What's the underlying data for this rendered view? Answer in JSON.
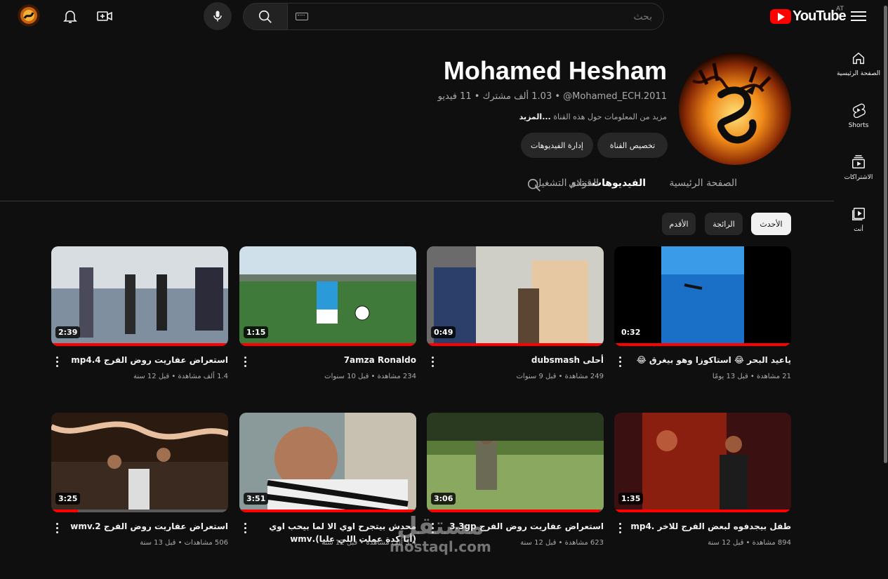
{
  "topbar": {
    "logo_text": "YouTube",
    "country_code": "AT",
    "search_placeholder": "بحث",
    "icons": [
      "menu-icon",
      "search-icon",
      "keyboard-icon",
      "mic-icon",
      "create-icon",
      "bell-icon"
    ]
  },
  "guide": {
    "items": [
      {
        "label": "الصفحة الرئيسية",
        "icon": "home-icon"
      },
      {
        "label": "Shorts",
        "icon": "shorts-icon"
      },
      {
        "label": "الاشتراكات",
        "icon": "subscriptions-icon"
      },
      {
        "label": "أنت",
        "icon": "you-icon"
      }
    ]
  },
  "channel": {
    "name": "Mohamed Hesham",
    "meta": "‎@Mohamed_ECH.2011 • ‏1.03 ألف مشترك • ‏11 فيديو",
    "more_text": "مزيد من المعلومات حول هذه القناة",
    "more_link": "...المزيد",
    "customize_button": "تخصيص القناة",
    "manage_button": "إدارة الفيديوهات"
  },
  "tabs": [
    {
      "label": "الصفحة الرئيسية",
      "active": false
    },
    {
      "label": "الفيديوهات",
      "active": true
    },
    {
      "label": "قوائم التشغيل",
      "active": false
    },
    {
      "label": "المنتدى",
      "active": false
    }
  ],
  "chips": [
    {
      "label": "الأحدث",
      "active": true
    },
    {
      "label": "الرائجة",
      "active": false
    },
    {
      "label": "الأقدم",
      "active": false
    }
  ],
  "videos": [
    {
      "title": "ياعيد البحر 😂 استاكوزا وهو بيغرق 😂",
      "meta": "21 مشاهدة • قبل 13 يومًا",
      "duration": "0:32",
      "progress": 1.0
    },
    {
      "title": "أحلى dubsmash",
      "meta": "249 مشاهدة • قبل 9 سنوات",
      "duration": "0:49",
      "progress": 1.0
    },
    {
      "title": "7amza Ronaldo",
      "meta": "234 مشاهدة • قبل 10 سنوات",
      "duration": "1:15",
      "progress": 1.0
    },
    {
      "title": "استعراض عفاريت روض الفرج mp4.4",
      "meta": "1.4 ألف مشاهدة • قبل 12 سنة",
      "duration": "2:39",
      "progress": 1.0
    },
    {
      "title": "طفل بيجدفوه لبعض الفرج للاخر .mp4",
      "meta": "894 مشاهدة • قبل 12 سنة",
      "duration": "1:35",
      "progress": 1.0
    },
    {
      "title": "استعراض عفاريت روض الفرج 3.3gp",
      "meta": "623 مشاهدة • قبل 12 سنة",
      "duration": "3:06",
      "progress": 0.98
    },
    {
      "title": "محدش بيتجرح اوي الا لما بيحب اوي (أنا كدة عملت اللي عليا).wmv",
      "meta": "3.4 ألف مشاهدة • قبل 12 سنة",
      "duration": "3:51",
      "progress": 1.0
    },
    {
      "title": "استعراض عفاريت روض الفرج wmv.2",
      "meta": "506 مشاهدات • قبل 13 سنة",
      "duration": "3:25",
      "progress": 0.15
    }
  ],
  "watermark": {
    "arabic": "مستقل",
    "latin": "mostaql.com"
  }
}
